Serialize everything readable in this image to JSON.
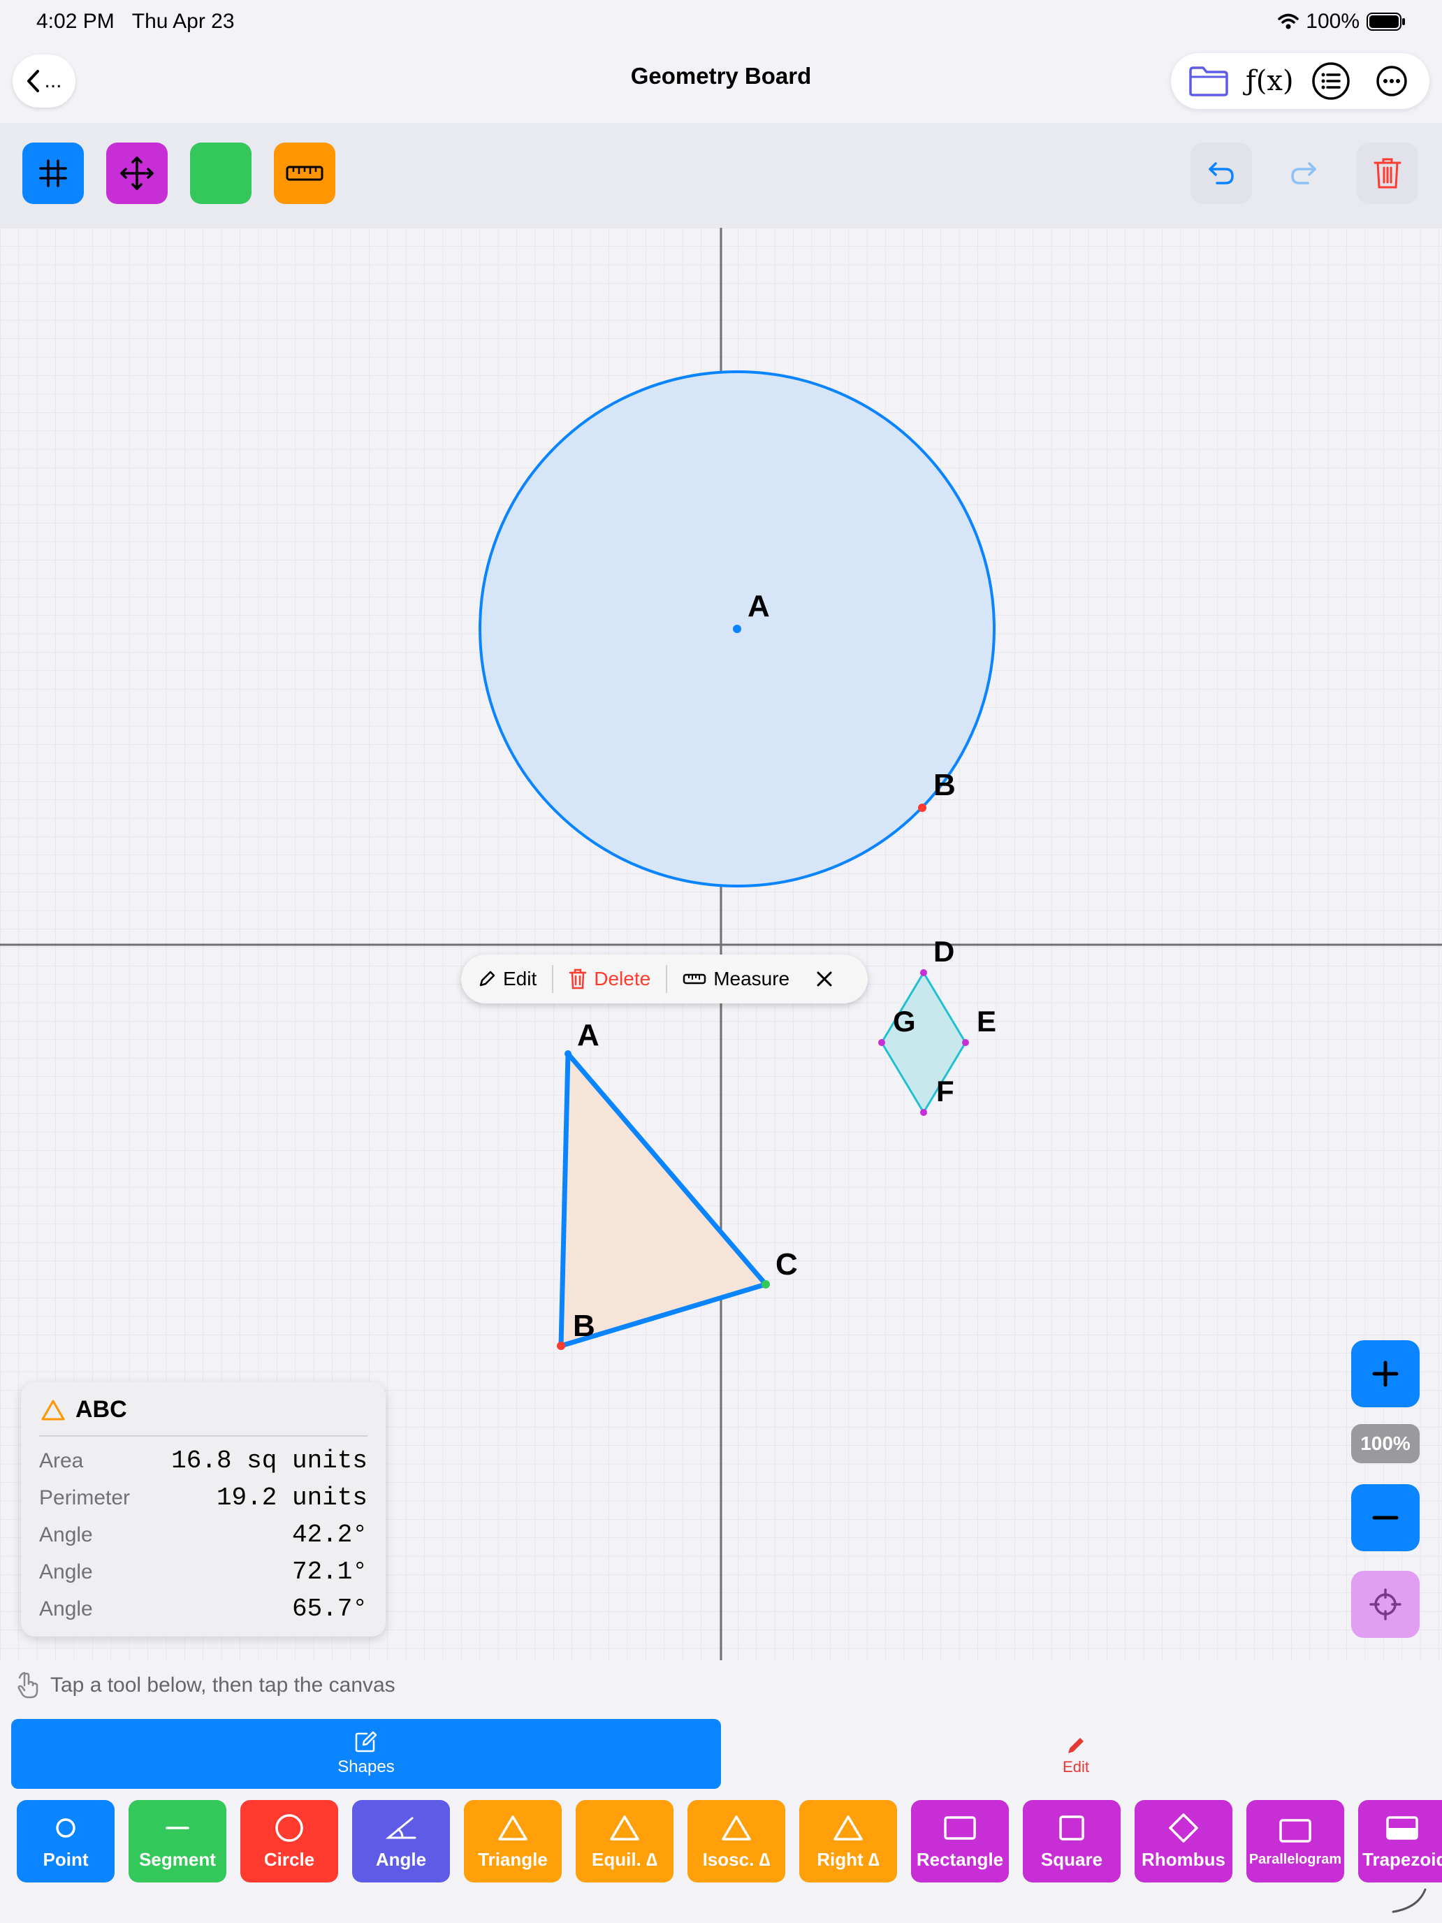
{
  "status": {
    "time": "4:02 PM",
    "date": "Thu Apr 23",
    "battery": "100%"
  },
  "nav": {
    "back_label": "...",
    "title": "Geometry Board",
    "fx_label": "ƒ(x)"
  },
  "toolbar": {
    "left_buttons": [
      {
        "icon": "grid-icon",
        "color": "#0a84ff"
      },
      {
        "icon": "move-icon",
        "color": "#c72ed6"
      },
      {
        "icon": "color-swatch",
        "color": "#34c759"
      },
      {
        "icon": "ruler-icon",
        "color": "#ff9500"
      }
    ],
    "right_buttons": [
      "undo-icon",
      "redo-icon",
      "trash-icon"
    ]
  },
  "canvas": {
    "circle": {
      "center_label": "A",
      "point_label": "B",
      "stroke": "#0a84ff",
      "fill": "#d6e6f8"
    },
    "triangle": {
      "labels": [
        "A",
        "B",
        "C"
      ],
      "stroke": "#0a84ff",
      "fill": "#f6e4d8"
    },
    "rhombus": {
      "labels": [
        "D",
        "E",
        "F",
        "G"
      ],
      "stroke": "#20c0d0",
      "fill": "#c9e8ee"
    }
  },
  "context_menu": {
    "edit": "Edit",
    "delete": "Delete",
    "measure": "Measure"
  },
  "info_panel": {
    "title": "ABC",
    "rows": [
      {
        "label": "Area",
        "value": "16.8 sq units"
      },
      {
        "label": "Perimeter",
        "value": "19.2 units"
      },
      {
        "label": "Angle",
        "value": "42.2°"
      },
      {
        "label": "Angle",
        "value": "72.1°"
      },
      {
        "label": "Angle",
        "value": "65.7°"
      }
    ]
  },
  "zoom": {
    "level": "100%"
  },
  "hint": "Tap a tool below, then tap the canvas",
  "tabs": {
    "shapes": "Shapes",
    "edit": "Edit"
  },
  "tools": [
    {
      "label": "Point",
      "color": "#0a84ff",
      "icon": "point-icon"
    },
    {
      "label": "Segment",
      "color": "#34c759",
      "icon": "segment-icon"
    },
    {
      "label": "Circle",
      "color": "#ff3b30",
      "icon": "circle-icon"
    },
    {
      "label": "Angle",
      "color": "#5e5ce6",
      "icon": "angle-icon"
    },
    {
      "label": "Triangle",
      "color": "#ff9f0a",
      "icon": "triangle-icon"
    },
    {
      "label": "Equil. ∆",
      "color": "#ff9f0a",
      "icon": "triangle-icon"
    },
    {
      "label": "Isosc. ∆",
      "color": "#ff9f0a",
      "icon": "triangle-icon"
    },
    {
      "label": "Right ∆",
      "color": "#ff9f0a",
      "icon": "triangle-icon"
    },
    {
      "label": "Rectangle",
      "color": "#c72ed6",
      "icon": "rectangle-icon"
    },
    {
      "label": "Square",
      "color": "#c72ed6",
      "icon": "square-icon"
    },
    {
      "label": "Rhombus",
      "color": "#c72ed6",
      "icon": "rhombus-icon"
    },
    {
      "label": "Parallelogram",
      "color": "#c72ed6",
      "icon": "parallelogram-icon"
    },
    {
      "label": "Trapezoid",
      "color": "#c72ed6",
      "icon": "trapezoid-icon"
    }
  ]
}
